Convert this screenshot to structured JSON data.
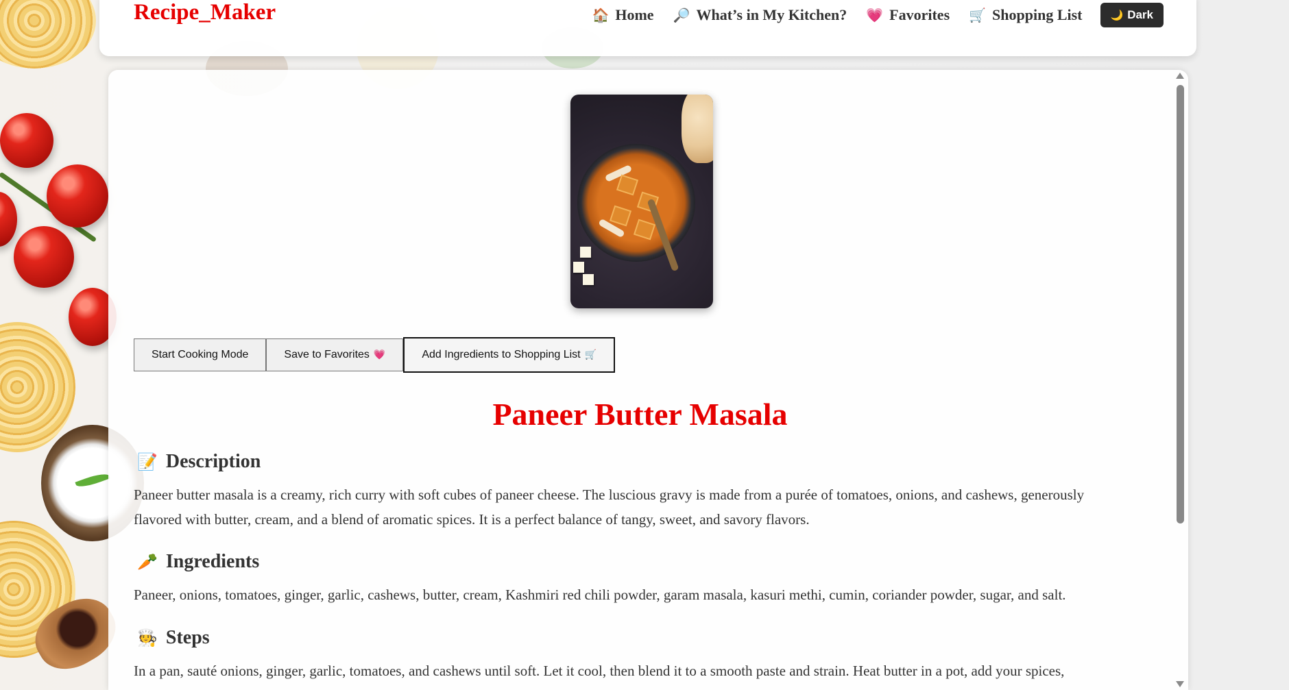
{
  "header": {
    "brand": "Recipe_Maker",
    "nav": [
      {
        "icon": "house-icon",
        "glyph": "🏠",
        "label": "Home"
      },
      {
        "icon": "magnifier-icon",
        "glyph": "🔎",
        "label": "What’s in My Kitchen?"
      },
      {
        "icon": "heart-icon",
        "glyph": "💗",
        "label": "Favorites"
      },
      {
        "icon": "cart-icon",
        "glyph": "🛒",
        "label": "Shopping List"
      }
    ],
    "theme_toggle": {
      "icon": "moon-icon",
      "glyph": "🌙",
      "label": "Dark"
    }
  },
  "recipe": {
    "image_alt": "Paneer Butter Masala dish photo",
    "actions": {
      "cooking_mode": "Start Cooking Mode",
      "favorites": "Save to Favorites",
      "favorites_icon": "💗",
      "shopping": "Add Ingredients to Shopping List",
      "shopping_icon": "🛒"
    },
    "title": "Paneer Butter Masala",
    "description": {
      "icon": "📝",
      "heading": "Description",
      "text": "Paneer butter masala is a creamy, rich curry with soft cubes of paneer cheese. The luscious gravy is made from a purée of tomatoes, onions, and cashews, generously flavored with butter, cream, and a blend of aromatic spices. It is a perfect balance of tangy, sweet, and savory flavors."
    },
    "ingredients": {
      "icon": "🥕",
      "heading": "Ingredients",
      "text": "Paneer, onions, tomatoes, ginger, garlic, cashews, butter, cream, Kashmiri red chili powder, garam masala, kasuri methi, cumin, coriander powder, sugar, and salt."
    },
    "steps": {
      "icon": "🧑‍🍳",
      "heading": "Steps",
      "text": "In a pan, sauté onions, ginger, garlic, tomatoes, and cashews until soft. Let it cool, then blend it to a smooth paste and strain. Heat butter in a pot, add your spices,"
    }
  },
  "colors": {
    "brand": "#e60000",
    "text": "#333333",
    "dark_button": "#2c2c2c"
  }
}
